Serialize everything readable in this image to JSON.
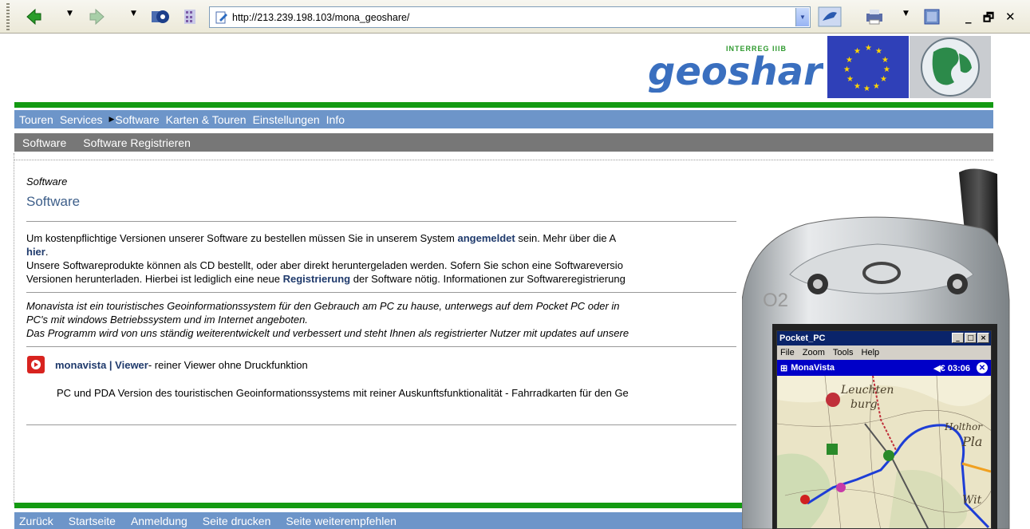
{
  "browser": {
    "url": "http://213.239.198.103/mona_geoshare/"
  },
  "header": {
    "logo_word": "geoshare",
    "logo_small": "INTERREG IIIB"
  },
  "nav_main": {
    "items": [
      "Touren",
      "Services",
      "Software",
      "Karten & Touren",
      "Einstellungen",
      "Info"
    ],
    "active_marker": "▶"
  },
  "nav_sub": {
    "items": [
      "Software",
      "Software Registrieren"
    ]
  },
  "content": {
    "breadcrumb": "Software",
    "title": "Software",
    "para1_a": "Um kostenpflichtige Versionen unserer Software zu bestellen müssen Sie in unserem System ",
    "para1_link": "angemeldet",
    "para1_b": " sein. Mehr über die A",
    "para1_link2": "hier",
    "para1_c": ".",
    "para2": "Unsere Softwareprodukte können als CD bestellt, oder aber direkt heruntergeladen werden. Sofern Sie schon eine Softwareversio",
    "para3_a": "Versionen herunterladen. Hierbei ist lediglich eine neue ",
    "para3_link": "Registrierung",
    "para3_b": " der Software nötig. Informationen zur Softwareregistrierung",
    "ital1": "Monavista ist ein touristisches Geoinformationssystem für den Gebrauch am PC zu hause, unterwegs auf dem Pocket PC oder in",
    "ital2": "PC's mit windows Betriebssystem und im Internet angeboten.",
    "ital3": "Das Programm wird von uns ständig weiterentwickelt und verbessert und steht Ihnen als registrierter Nutzer mit updates auf unsere",
    "viewer_name": "monavista | Viewer",
    "viewer_desc": " - reiner Viewer ohne Druckfunktion",
    "viewer_line": "PC und PDA Version des touristischen Geoinformationssystems mit reiner Auskunftsfunktionalität - Fahrradkarten für den Ge"
  },
  "footer": {
    "items": [
      "Zurück",
      "Startseite",
      "Anmeldung",
      "Seite drucken",
      "Seite weiterempfehlen"
    ]
  },
  "pda": {
    "brand": "O2",
    "window_title": "Pocket_PC",
    "menu": [
      "File",
      "Zoom",
      "Tools",
      "Help"
    ],
    "app_title": "MonaVista",
    "time": "◀€ 03:06",
    "map_labels": [
      "Leuchten",
      "burg",
      "Holthor",
      "Pla",
      "Wit"
    ]
  },
  "colors": {
    "nav_blue": "#6d95c9",
    "green": "#139a12",
    "link": "#1f3a6c",
    "heading": "#3e5f8a"
  }
}
